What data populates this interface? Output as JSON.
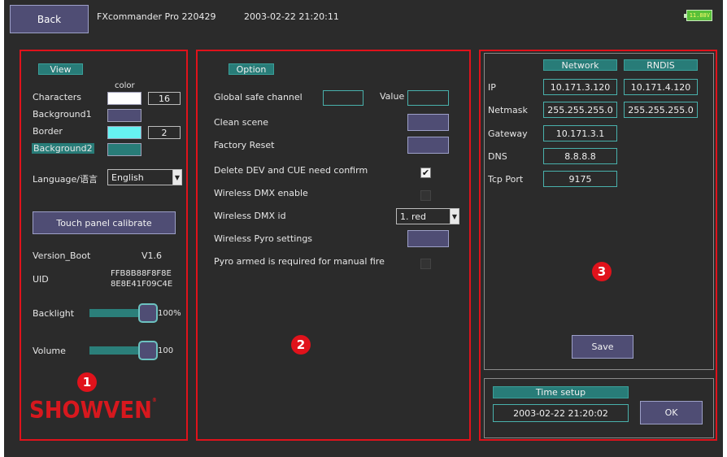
{
  "header": {
    "back_label": "Back",
    "app_title": "FXcommander Pro 220429",
    "datetime": "2003-02-22 21:20:11",
    "battery": "11.88V"
  },
  "view_panel": {
    "tag": "View",
    "color_header": "color",
    "characters_label": "Characters",
    "characters_value": "16",
    "background1_label": "Background1",
    "border_label": "Border",
    "border_value": "2",
    "background2_label": "Background2",
    "language_label": "Language/语言",
    "language_value": "English",
    "touch_btn": "Touch panel calibrate",
    "version_label": "Version_Boot",
    "version_value": "V1.6",
    "uid_label": "UID",
    "uid_line1": "FFB8B88F8F8E",
    "uid_line2": "8E8E41F09C4E",
    "backlight_label": "Backlight",
    "backlight_value": "100%",
    "volume_label": "Volume",
    "volume_value": "100",
    "badge": "1",
    "logo": "SHOWVEN",
    "colors": {
      "characters": "#ffffff",
      "background1": "#4f4d74",
      "border": "#66f2f2",
      "background2": "#287c78"
    },
    "backlight_level": 1.0,
    "volume_level": 1.0
  },
  "option_panel": {
    "tag": "Option",
    "global_safe_label": "Global safe channel",
    "value_label": "Value",
    "clean_scene_label": "Clean scene",
    "factory_reset_label": "Factory Reset",
    "delete_confirm_label": "Delete DEV and CUE need confirm",
    "delete_confirm_checked": true,
    "wireless_dmx_enable_label": "Wireless DMX enable",
    "wireless_dmx_enable_checked": false,
    "wireless_dmx_id_label": "Wireless DMX id",
    "wireless_dmx_id_value": "1. red",
    "wireless_pyro_label": "Wireless Pyro settings",
    "pyro_armed_label": "Pyro armed is required for manual fire",
    "pyro_armed_checked": false,
    "badge": "2"
  },
  "network_panel": {
    "network_tag": "Network",
    "rndis_tag": "RNDIS",
    "ip_label": "IP",
    "ip_network": "10.171.3.120",
    "ip_rndis": "10.171.4.120",
    "netmask_label": "Netmask",
    "netmask_network": "255.255.255.0",
    "netmask_rndis": "255.255.255.0",
    "gateway_label": "Gateway",
    "gateway_value": "10.171.3.1",
    "dns_label": "DNS",
    "dns_value": "8.8.8.8",
    "tcp_port_label": "Tcp Port",
    "tcp_port_value": "9175",
    "save_label": "Save",
    "badge": "3",
    "time_setup_tag": "Time setup",
    "time_value": "2003-02-22 21:20:02",
    "ok_label": "OK"
  }
}
